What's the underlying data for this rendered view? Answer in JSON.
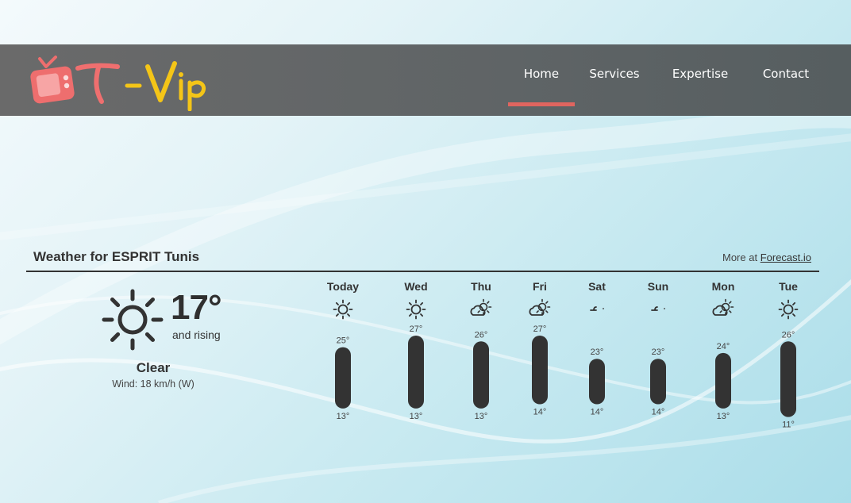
{
  "brand": {
    "logo_text": "T-Vip",
    "colors": {
      "tv": "#ee6e6e",
      "t_letter": "#ef6f6f",
      "vip": "#f4c517"
    }
  },
  "nav": {
    "items": [
      {
        "label": "Home",
        "active": true
      },
      {
        "label": "Services",
        "active": false
      },
      {
        "label": "Expertise",
        "active": false
      },
      {
        "label": "Contact",
        "active": false
      }
    ],
    "active_color": "#e0655f"
  },
  "weather": {
    "title": "Weather for ESPRIT Tunis",
    "more_prefix": "More at ",
    "more_link": "Forecast.io",
    "current": {
      "icon": "clear-day-icon",
      "temp": "17°",
      "trend": "and rising",
      "summary": "Clear",
      "wind": "Wind: 18 km/h (W)"
    },
    "forecast": [
      {
        "day": "Today",
        "icon": "clear-day-icon",
        "high": 25,
        "low": 13
      },
      {
        "day": "Wed",
        "icon": "clear-day-icon",
        "high": 27,
        "low": 13
      },
      {
        "day": "Thu",
        "icon": "partly-cloudy-icon",
        "high": 26,
        "low": 13
      },
      {
        "day": "Fri",
        "icon": "partly-cloudy-day-icon",
        "high": 27,
        "low": 14
      },
      {
        "day": "Sat",
        "icon": "wind-icon",
        "high": 23,
        "low": 14
      },
      {
        "day": "Sun",
        "icon": "wind-icon",
        "high": 23,
        "low": 14
      },
      {
        "day": "Mon",
        "icon": "partly-cloudy-day-icon",
        "high": 24,
        "low": 13
      },
      {
        "day": "Tue",
        "icon": "clear-day-icon",
        "high": 26,
        "low": 11
      }
    ],
    "bar_color": "#333333"
  }
}
